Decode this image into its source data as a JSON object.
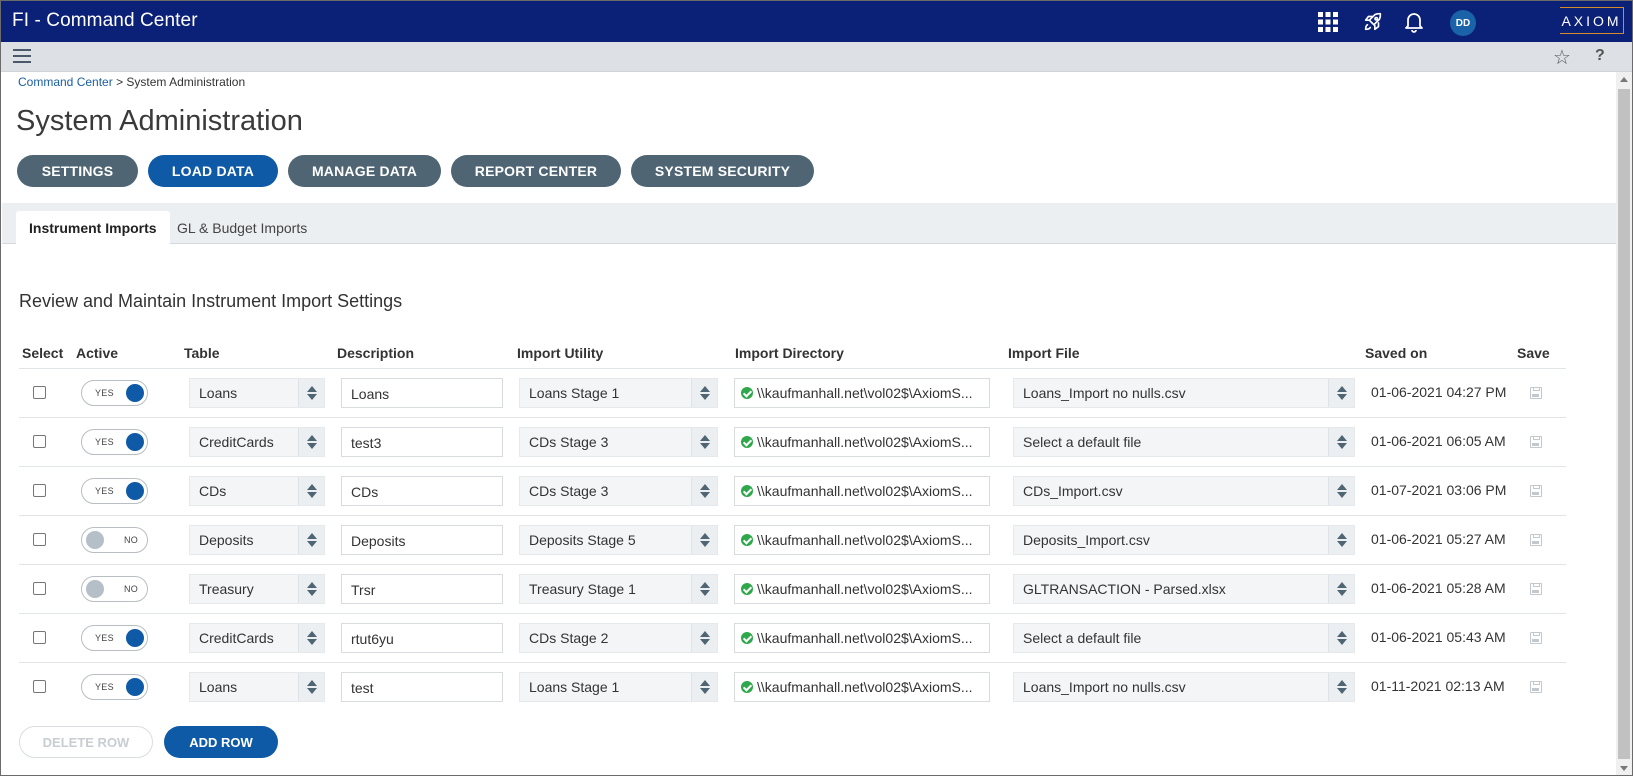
{
  "app": {
    "title": "FI - Command Center",
    "logo_text": "AXIOM",
    "avatar_initials": "DD"
  },
  "colors": {
    "topbar": "#0b2077",
    "accent": "#0f5aa6",
    "nav_button": "#4f6573",
    "logo_border": "#d58a2c",
    "status_ok": "#2ea84a"
  },
  "topbar_icons": [
    "apps-grid-icon",
    "rocket-icon",
    "bell-icon"
  ],
  "subbar_icons": [
    "menu-icon",
    "star-icon",
    "help-icon"
  ],
  "subbar": {
    "help_label": "?"
  },
  "breadcrumb": {
    "root": "Command Center",
    "separator": ">",
    "current": "System Administration"
  },
  "page_title": "System Administration",
  "nav_buttons": [
    {
      "label": "SETTINGS",
      "active": false
    },
    {
      "label": "LOAD DATA",
      "active": true
    },
    {
      "label": "MANAGE DATA",
      "active": false
    },
    {
      "label": "REPORT CENTER",
      "active": false
    },
    {
      "label": "SYSTEM SECURITY",
      "active": false
    }
  ],
  "tabs": [
    {
      "label": "Instrument Imports",
      "active": true
    },
    {
      "label": "GL & Budget Imports",
      "active": false
    }
  ],
  "section_title": "Review and Maintain Instrument Import Settings",
  "table": {
    "columns": [
      "Select",
      "Active",
      "Table",
      "Description",
      "Import Utility",
      "Import Directory",
      "Import File",
      "Saved on",
      "Save"
    ],
    "rows": [
      {
        "selected": false,
        "active": true,
        "active_label": "YES",
        "table": "Loans",
        "description": "Loans",
        "utility": "Loans Stage 1",
        "directory": "\\\\kaufmanhall.net\\vol02$\\AxiomS...",
        "file": "Loans_Import no nulls.csv",
        "saved_on": "01-06-2021 04:27 PM"
      },
      {
        "selected": false,
        "active": true,
        "active_label": "YES",
        "table": "CreditCards",
        "description": "test3",
        "utility": "CDs Stage 3",
        "directory": "\\\\kaufmanhall.net\\vol02$\\AxiomS...",
        "file": "Select a default file",
        "saved_on": "01-06-2021 06:05 AM"
      },
      {
        "selected": false,
        "active": true,
        "active_label": "YES",
        "table": "CDs",
        "description": "CDs",
        "utility": "CDs Stage 3",
        "directory": "\\\\kaufmanhall.net\\vol02$\\AxiomS...",
        "file": "CDs_Import.csv",
        "saved_on": "01-07-2021 03:06 PM"
      },
      {
        "selected": false,
        "active": false,
        "active_label": "NO",
        "table": "Deposits",
        "description": "Deposits",
        "utility": "Deposits Stage 5",
        "directory": "\\\\kaufmanhall.net\\vol02$\\AxiomS...",
        "file": "Deposits_Import.csv",
        "saved_on": "01-06-2021 05:27 AM"
      },
      {
        "selected": false,
        "active": false,
        "active_label": "NO",
        "table": "Treasury",
        "description": "Trsr",
        "utility": "Treasury Stage 1",
        "directory": "\\\\kaufmanhall.net\\vol02$\\AxiomS...",
        "file": "GLTRANSACTION - Parsed.xlsx",
        "saved_on": "01-06-2021 05:28 AM"
      },
      {
        "selected": false,
        "active": true,
        "active_label": "YES",
        "table": "CreditCards",
        "description": "rtut6yu",
        "utility": "CDs Stage 2",
        "directory": "\\\\kaufmanhall.net\\vol02$\\AxiomS...",
        "file": "Select a default file",
        "saved_on": "01-06-2021 05:43 AM"
      },
      {
        "selected": false,
        "active": true,
        "active_label": "YES",
        "table": "Loans",
        "description": "test",
        "utility": "Loans Stage 1",
        "directory": "\\\\kaufmanhall.net\\vol02$\\AxiomS...",
        "file": "Loans_Import no nulls.csv",
        "saved_on": "01-11-2021 02:13 AM"
      }
    ]
  },
  "actions": {
    "delete_label": "DELETE ROW",
    "add_label": "ADD ROW"
  }
}
